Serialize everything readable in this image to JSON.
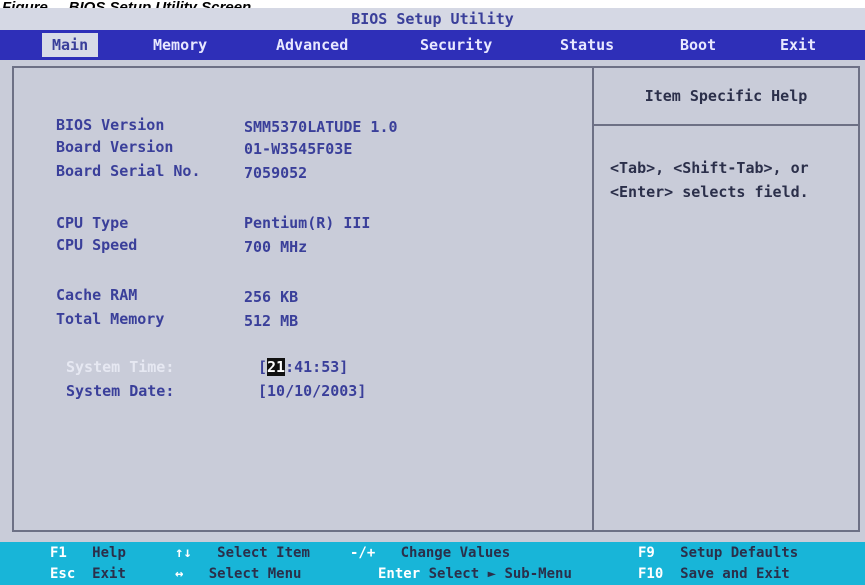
{
  "caption": "Figure ... BIOS Setup Utility Screen",
  "title": "BIOS Setup Utility",
  "menu": [
    {
      "label": "Main"
    },
    {
      "label": "Memory"
    },
    {
      "label": "Advanced"
    },
    {
      "label": "Security"
    },
    {
      "label": "Status"
    },
    {
      "label": "Boot"
    },
    {
      "label": "Exit"
    }
  ],
  "fields": {
    "bios_version": {
      "label": "BIOS Version",
      "value": "SMM5370LATUDE 1.0"
    },
    "board_version": {
      "label": "Board Version",
      "value": "01-W3545F03E"
    },
    "board_serial": {
      "label": "Board Serial No.",
      "value": "7059052"
    },
    "cpu_type": {
      "label": "CPU Type",
      "value": "Pentium(R) III"
    },
    "cpu_speed": {
      "label": "CPU Speed",
      "value": "700 MHz"
    },
    "cache_ram": {
      "label": "Cache RAM",
      "value": "256 KB"
    },
    "total_memory": {
      "label": "Total Memory",
      "value": "512 MB"
    },
    "system_time": {
      "label": "System Time:",
      "value_open": "[",
      "value_hour": "21",
      "value_rest": ":41:53]"
    },
    "system_date": {
      "label": "System Date:",
      "value": "[10/10/2003]"
    }
  },
  "help": {
    "title": "Item Specific Help",
    "text": "<Tab>, <Shift-Tab>, or <Enter> selects field."
  },
  "footer": [
    {
      "key": "F1",
      "desc": "Help"
    },
    {
      "key": "Esc",
      "desc": "Exit"
    },
    {
      "key": "↑↓",
      "desc": "Select Item"
    },
    {
      "key": "↔",
      "desc": "Select Menu"
    },
    {
      "key": "-/+",
      "desc": "Change Values"
    },
    {
      "key": "Enter",
      "desc": "Select ► Sub-Menu"
    },
    {
      "key": "F9",
      "desc": "Setup Defaults"
    },
    {
      "key": "F10",
      "desc": "Save and Exit"
    }
  ],
  "colors": {
    "menubar": "#2e2fb8",
    "footer": "#18b5d8",
    "panel": "#c9ccd9"
  }
}
